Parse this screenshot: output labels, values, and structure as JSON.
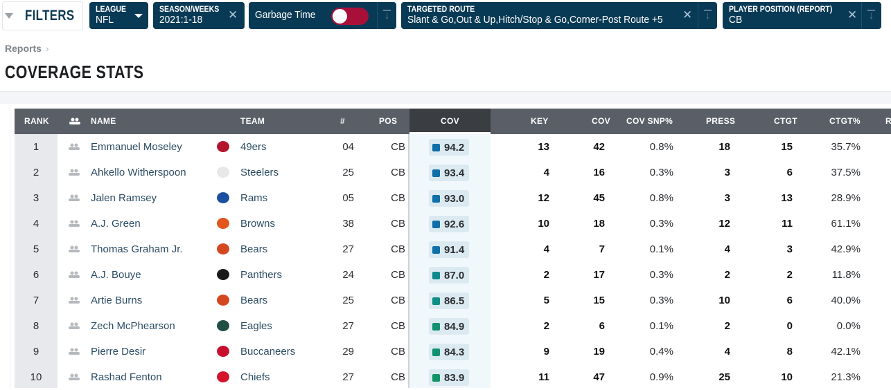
{
  "filters": {
    "label": "FILTERS",
    "league": {
      "title": "LEAGUE",
      "value": "NFL"
    },
    "season": {
      "title": "SEASON/WEEKS",
      "value": "2021:1-18"
    },
    "garbage": {
      "label": "Garbage Time",
      "on": false
    },
    "route": {
      "title": "TARGETED ROUTE",
      "value": "Slant & Go,Out & Up,Hitch/Stop & Go,Corner-Post Route +5"
    },
    "position": {
      "title": "PLAYER POSITION (REPORT)",
      "value": "CB"
    }
  },
  "breadcrumb": {
    "item": "Reports",
    "sep": "›"
  },
  "page_title": "COVERAGE STATS",
  "columns": {
    "rank": "RANK",
    "name": "NAME",
    "team": "TEAM",
    "num": "#",
    "pos": "POS",
    "cov_grade": "COV",
    "key": "KEY",
    "cov": "COV",
    "cov_snp": "COV SNP%",
    "press": "PRESS",
    "ctgt": "CTGT",
    "ctgt_pct": "CTGT%",
    "next": "R"
  },
  "rows": [
    {
      "rank": "1",
      "name": "Emmanuel Moseley",
      "team": "49ers",
      "logo": "#b3152d",
      "num": "04",
      "pos": "CB",
      "grade": "94.2",
      "gc": "#0f6fa8",
      "key": "13",
      "cov": "42",
      "snp": "0.8%",
      "press": "18",
      "ctgt": "15",
      "ctgtp": "35.7%"
    },
    {
      "rank": "2",
      "name": "Ahkello Witherspoon",
      "team": "Steelers",
      "logo": "#e8e8e8",
      "num": "25",
      "pos": "CB",
      "grade": "93.4",
      "gc": "#0f6fa8",
      "key": "4",
      "cov": "16",
      "snp": "0.3%",
      "press": "3",
      "ctgt": "6",
      "ctgtp": "37.5%"
    },
    {
      "rank": "3",
      "name": "Jalen Ramsey",
      "team": "Rams",
      "logo": "#1d4fa0",
      "num": "05",
      "pos": "CB",
      "grade": "93.0",
      "gc": "#0f6fa8",
      "key": "12",
      "cov": "45",
      "snp": "0.8%",
      "press": "3",
      "ctgt": "13",
      "ctgtp": "28.9%"
    },
    {
      "rank": "4",
      "name": "A.J. Green",
      "team": "Browns",
      "logo": "#e2561c",
      "num": "38",
      "pos": "CB",
      "grade": "92.6",
      "gc": "#0f6fa8",
      "key": "10",
      "cov": "18",
      "snp": "0.3%",
      "press": "12",
      "ctgt": "11",
      "ctgtp": "61.1%"
    },
    {
      "rank": "5",
      "name": "Thomas Graham Jr.",
      "team": "Bears",
      "logo": "#d5471f",
      "num": "27",
      "pos": "CB",
      "grade": "91.4",
      "gc": "#0f6fa8",
      "key": "4",
      "cov": "7",
      "snp": "0.1%",
      "press": "4",
      "ctgt": "3",
      "ctgtp": "42.9%"
    },
    {
      "rank": "6",
      "name": "A.J. Bouye",
      "team": "Panthers",
      "logo": "#1a1a1a",
      "num": "24",
      "pos": "CB",
      "grade": "87.0",
      "gc": "#0e8a8f",
      "key": "2",
      "cov": "17",
      "snp": "0.3%",
      "press": "2",
      "ctgt": "2",
      "ctgtp": "11.8%"
    },
    {
      "rank": "7",
      "name": "Artie Burns",
      "team": "Bears",
      "logo": "#d5471f",
      "num": "25",
      "pos": "CB",
      "grade": "86.5",
      "gc": "#0e8f85",
      "key": "5",
      "cov": "15",
      "snp": "0.3%",
      "press": "10",
      "ctgt": "6",
      "ctgtp": "40.0%"
    },
    {
      "rank": "8",
      "name": "Zech McPhearson",
      "team": "Eagles",
      "logo": "#1f4e45",
      "num": "27",
      "pos": "CB",
      "grade": "84.9",
      "gc": "#109272",
      "key": "2",
      "cov": "6",
      "snp": "0.1%",
      "press": "2",
      "ctgt": "0",
      "ctgtp": "0.0%"
    },
    {
      "rank": "9",
      "name": "Pierre Desir",
      "team": "Buccaneers",
      "logo": "#c8102e",
      "num": "29",
      "pos": "CB",
      "grade": "84.3",
      "gc": "#109272",
      "key": "9",
      "cov": "19",
      "snp": "0.4%",
      "press": "4",
      "ctgt": "8",
      "ctgtp": "42.1%"
    },
    {
      "rank": "10",
      "name": "Rashad Fenton",
      "team": "Chiefs",
      "logo": "#d3142b",
      "num": "27",
      "pos": "CB",
      "grade": "83.9",
      "gc": "#119468",
      "key": "11",
      "cov": "47",
      "snp": "0.9%",
      "press": "25",
      "ctgt": "10",
      "ctgtp": "21.3%"
    }
  ]
}
